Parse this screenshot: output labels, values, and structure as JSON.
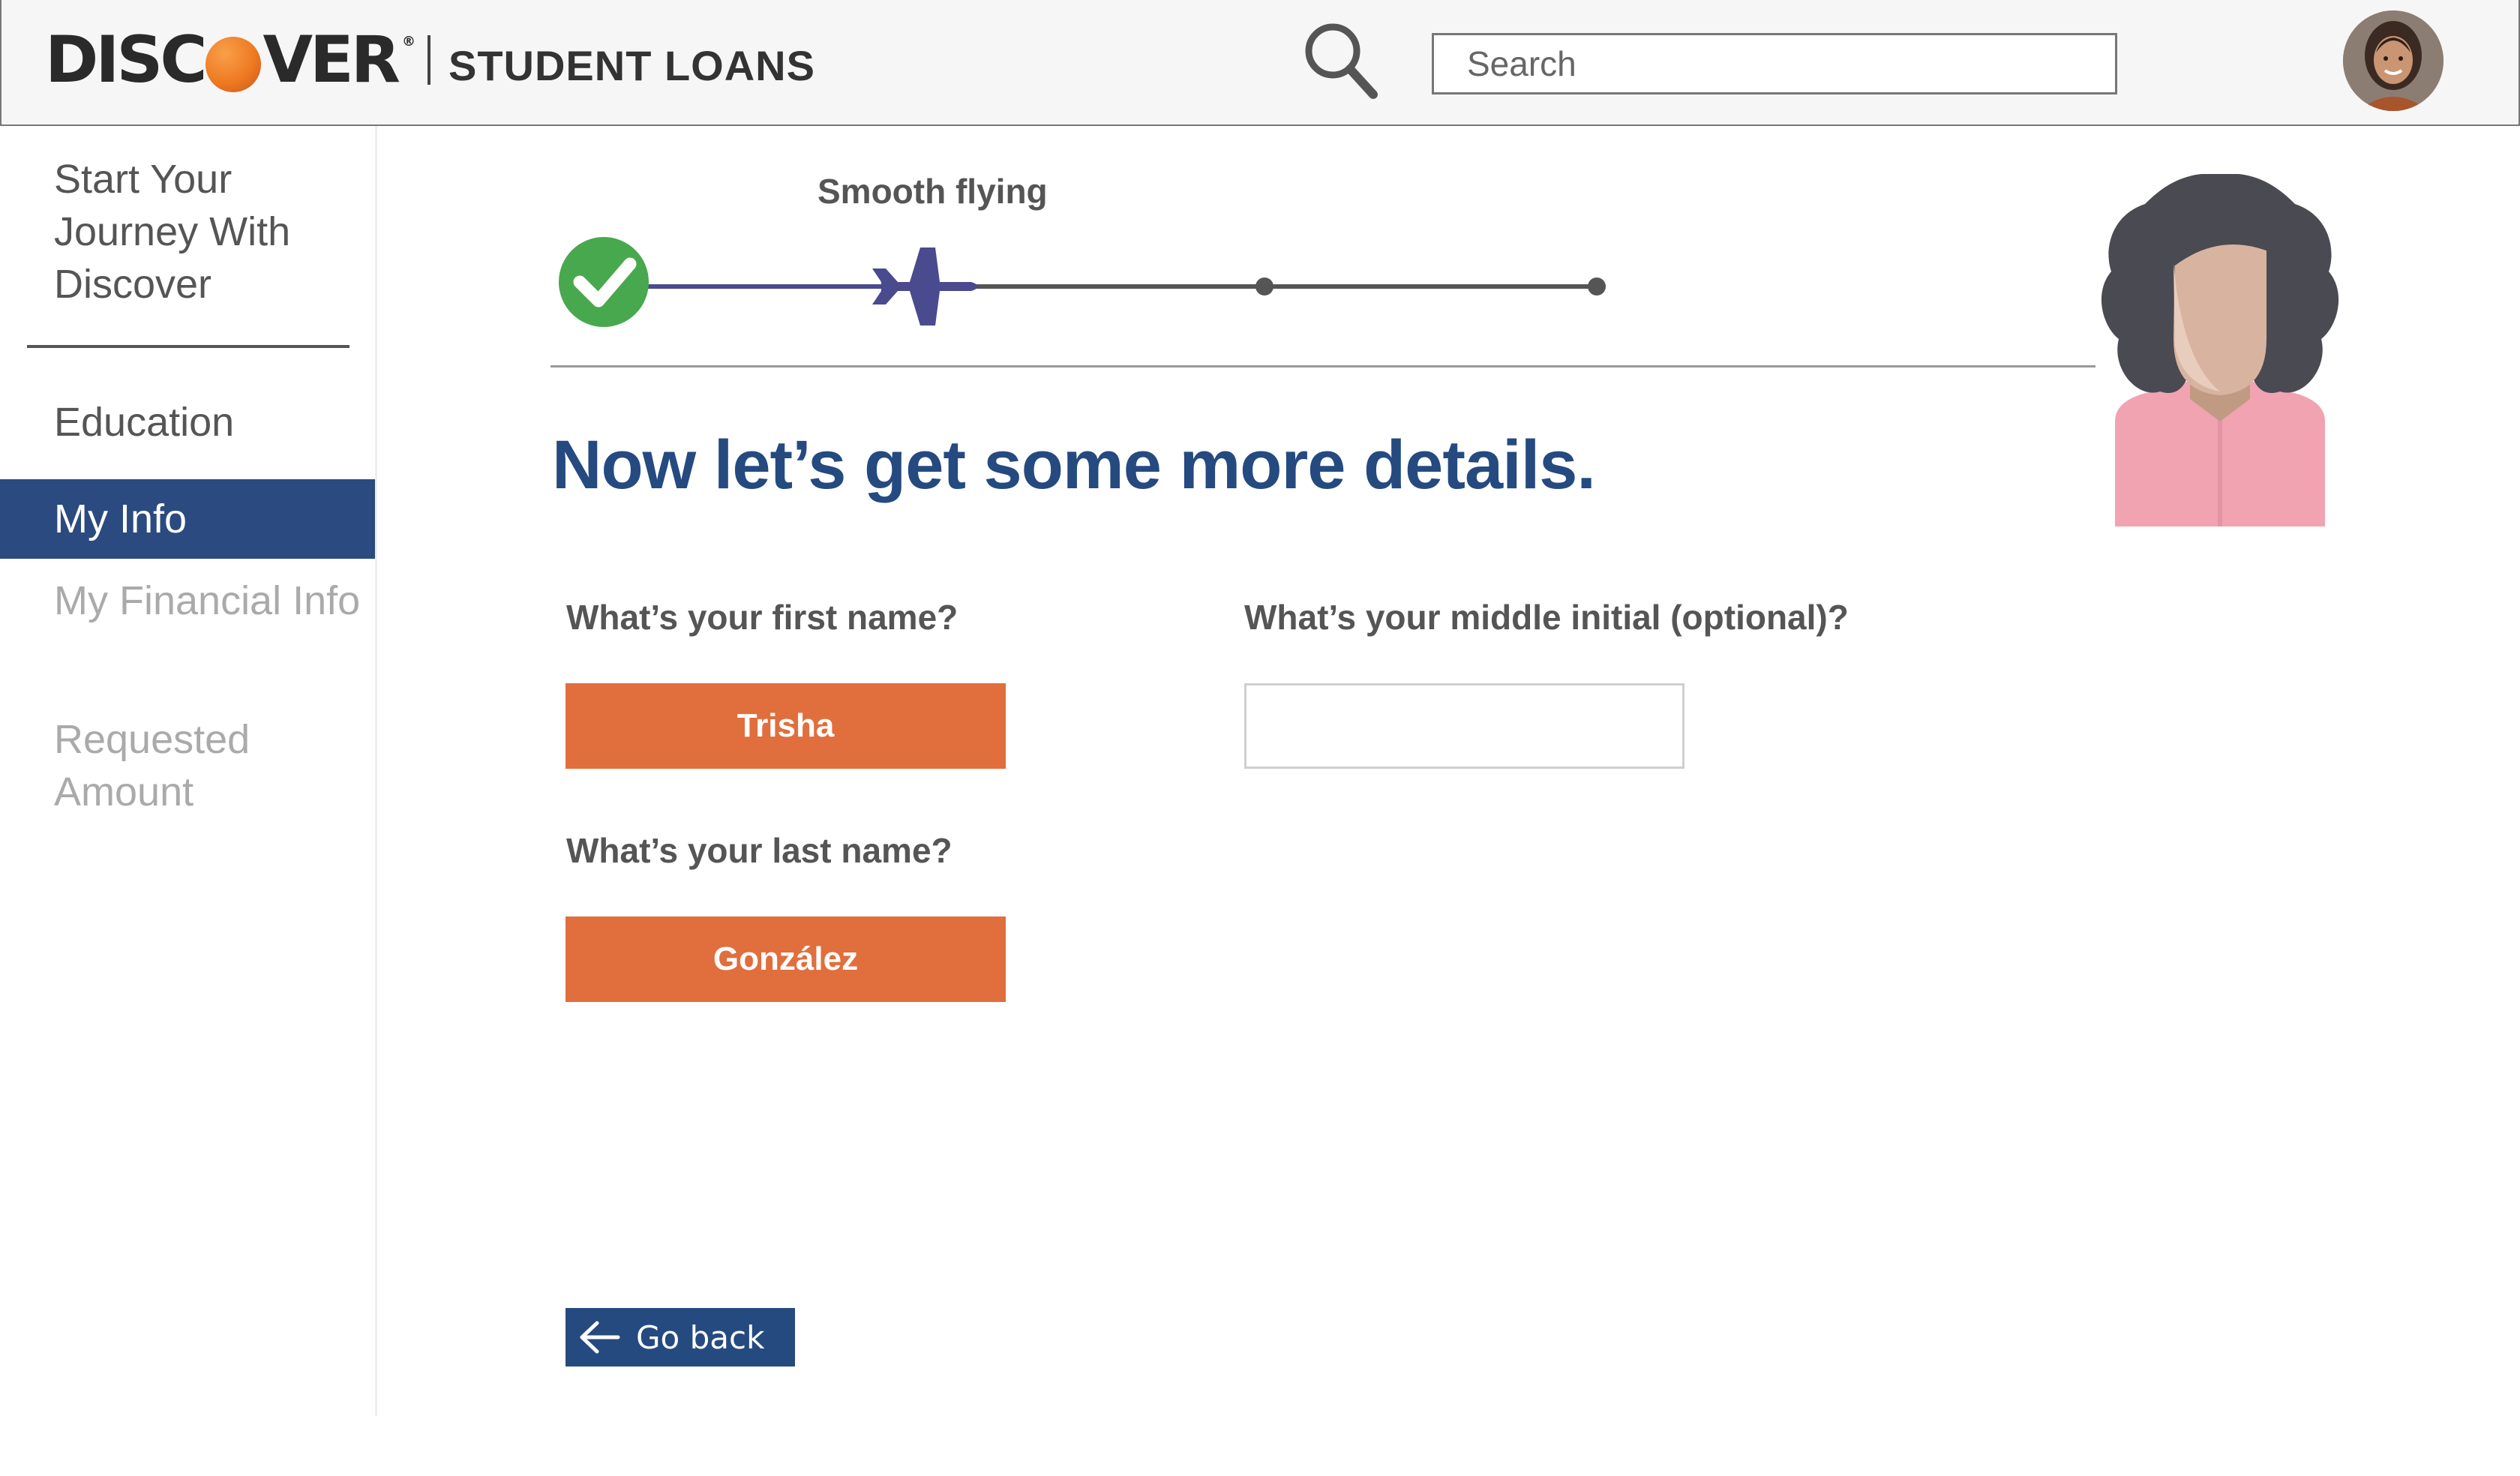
{
  "brand": {
    "logo_left": "DISC",
    "logo_right": "VER",
    "logo_registered": "®",
    "logo_subtitle": "STUDENT LOANS",
    "accent_orange": "#e16e3d",
    "navy": "#254a80"
  },
  "search": {
    "placeholder": "Search",
    "icon": "search-icon"
  },
  "user": {
    "avatar": "user-avatar"
  },
  "sidebar": {
    "journey": "Start Your Journey With Discover",
    "items": [
      {
        "label": "Education",
        "state": "completed"
      },
      {
        "label": "My Info",
        "state": "active"
      },
      {
        "label": "My Financial Info",
        "state": "upcoming"
      },
      {
        "label": "Requested Amount",
        "state": "upcoming"
      }
    ]
  },
  "progress": {
    "label": "Smooth flying",
    "steps_total": 4,
    "current_step": 2,
    "icons": [
      "check-circle-icon",
      "airplane-icon"
    ]
  },
  "main": {
    "title": "Now let’s get some more details.",
    "fields": {
      "first_name": {
        "label": "What’s your first name?",
        "value": "Trisha"
      },
      "middle_initial": {
        "label": "What’s your middle initial (optional)?",
        "value": ""
      },
      "last_name": {
        "label": "What’s your last name?",
        "value": "González"
      }
    },
    "go_back": "Go back"
  }
}
